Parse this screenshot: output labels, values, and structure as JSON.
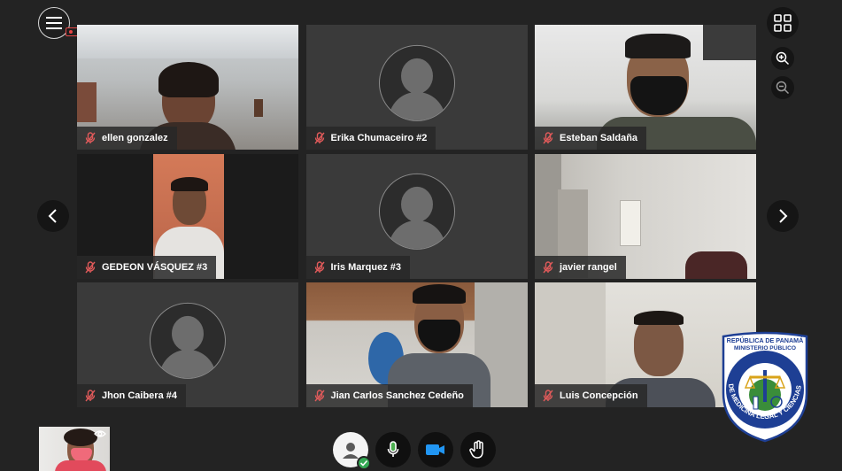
{
  "participants": [
    {
      "name": "ellen gonzalez",
      "video": true,
      "mic_muted": true
    },
    {
      "name": "Erika Chumaceiro #2",
      "video": false,
      "mic_muted": true
    },
    {
      "name": "Esteban Saldaña",
      "video": true,
      "mic_muted": true
    },
    {
      "name": "GEDEON VÁSQUEZ #3",
      "video": true,
      "mic_muted": true
    },
    {
      "name": "Iris Marquez #3",
      "video": false,
      "mic_muted": true
    },
    {
      "name": "javier rangel",
      "video": true,
      "mic_muted": true
    },
    {
      "name": "Jhon Caibera #4",
      "video": false,
      "mic_muted": true
    },
    {
      "name": "Jian Carlos Sanchez Cedeño",
      "video": true,
      "mic_muted": true
    },
    {
      "name": "Luis Concepción",
      "video": true,
      "mic_muted": true
    }
  ],
  "seal": {
    "line1": "REPÚBLICA DE PANAMÁ",
    "line2": "MINISTERIO PÚBLICO",
    "arc_text": "INSTITUTO DE MEDICINA LEGAL Y CIENCIAS FORENSES"
  },
  "icons": {
    "menu": "hamburger-icon",
    "recording": "recording-icon",
    "layout": "grid-layout-icon",
    "zoom_in": "zoom-in-icon",
    "zoom_out": "zoom-out-icon",
    "prev": "chevron-left-icon",
    "next": "chevron-right-icon",
    "mic_off": "mic-off-icon",
    "user_status": "user-status-icon",
    "mic": "microphone-icon",
    "camera": "camera-icon",
    "hand": "raise-hand-icon",
    "self_view": "eye-icon"
  },
  "colors": {
    "background": "#232323",
    "mic_off": "#e05a5a",
    "camera_active": "#2196f3",
    "mic_active": "#4caf50",
    "status_ok": "#34a853"
  }
}
